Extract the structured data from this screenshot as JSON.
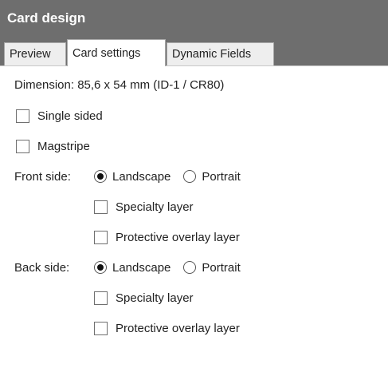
{
  "panel": {
    "title": "Card design"
  },
  "tabs": [
    {
      "label": "Preview",
      "active": false
    },
    {
      "label": "Card settings",
      "active": true
    },
    {
      "label": "Dynamic Fields",
      "active": false
    }
  ],
  "settings": {
    "dimension": "Dimension: 85,6 x 54 mm (ID-1 / CR80)",
    "single_sided": {
      "label": "Single sided",
      "checked": false
    },
    "magstripe": {
      "label": "Magstripe",
      "checked": false
    },
    "front": {
      "label": "Front side:",
      "landscape": {
        "label": "Landscape",
        "selected": true
      },
      "portrait": {
        "label": "Portrait",
        "selected": false
      },
      "specialty": {
        "label": "Specialty layer",
        "checked": false
      },
      "overlay": {
        "label": "Protective overlay layer",
        "checked": false
      }
    },
    "back": {
      "label": "Back side:",
      "landscape": {
        "label": "Landscape",
        "selected": true
      },
      "portrait": {
        "label": "Portrait",
        "selected": false
      },
      "specialty": {
        "label": "Specialty layer",
        "checked": false
      },
      "overlay": {
        "label": "Protective overlay layer",
        "checked": false
      }
    }
  },
  "colors": {
    "header_bg": "#6e6e6e",
    "header_text": "#ffffff",
    "tab_inactive": "#eeeeee"
  }
}
